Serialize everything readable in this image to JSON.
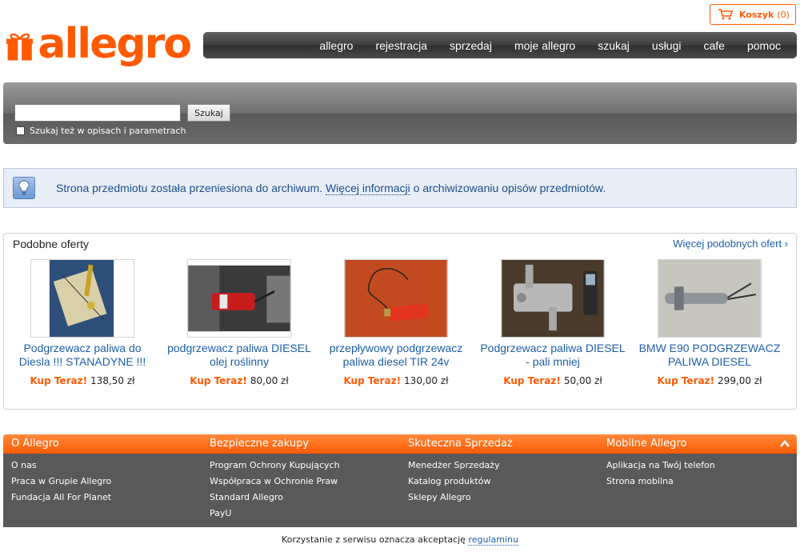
{
  "header": {
    "logo_text": "allegro",
    "cart_label": "Koszyk",
    "cart_count": "(0)",
    "nav": [
      "allegro",
      "rejestracja",
      "sprzedaj",
      "moje allegro",
      "szukaj",
      "usługi",
      "cafe",
      "pomoc"
    ]
  },
  "search": {
    "button_label": "Szukaj",
    "input_value": "",
    "checkbox_label": "Szukaj też w opisach i parametrach"
  },
  "info": {
    "text_before": "Strona przedmiotu została przeniesiona do archiwum. ",
    "link": "Więcej informacji",
    "text_after": " o archiwizowaniu opisów przedmiotów."
  },
  "similar": {
    "title": "Podobne oferty",
    "more_link": "Więcej podobnych ofert ›",
    "offers": [
      {
        "title": "Podgrzewacz paliwa do Diesla !!! STANADYNE !!!",
        "kup": "Kup Teraz!",
        "price": "138,50 zł"
      },
      {
        "title": "podgrzewacz paliwa DIESEL olej roślinny",
        "kup": "Kup Teraz!",
        "price": "80,00 zł"
      },
      {
        "title": "przepływowy podgrzewacz paliwa diesel TIR 24v",
        "kup": "Kup Teraz!",
        "price": "130,00 zł"
      },
      {
        "title": "Podgrzewacz paliwa DIESEL - pali mniej",
        "kup": "Kup Teraz!",
        "price": "50,00 zł"
      },
      {
        "title": "BMW E90 PODGRZEWACZ PALIWA DIESEL",
        "kup": "Kup Teraz!",
        "price": "299,00 zł"
      }
    ]
  },
  "footer": {
    "columns": [
      {
        "title": "O Allegro",
        "links": [
          "O nas",
          "Praca w Grupie Allegro",
          "Fundacja All For Planet"
        ]
      },
      {
        "title": "Bezpieczne zakupy",
        "links": [
          "Program Ochrony Kupujących",
          "Współpraca w Ochronie Praw",
          "Standard Allegro",
          "PayU"
        ]
      },
      {
        "title": "Skuteczna Sprzedaż",
        "links": [
          "Menedżer Sprzedaży",
          "Katalog produktów",
          "Sklepy Allegro"
        ]
      },
      {
        "title": "Mobilne Allegro",
        "links": [
          "Aplikacja na Twój telefon",
          "Strona mobilna"
        ]
      }
    ],
    "terms_text": "Korzystanie z serwisu oznacza akceptację ",
    "terms_link": "regulaminu"
  },
  "colors": {
    "brand": "#ff5a00",
    "link": "#1d5ea8",
    "info_bg": "#e8eef7"
  },
  "icons": [
    "gift-logo-icon",
    "cart-icon",
    "lightbulb-icon",
    "chevron-up-icon"
  ]
}
